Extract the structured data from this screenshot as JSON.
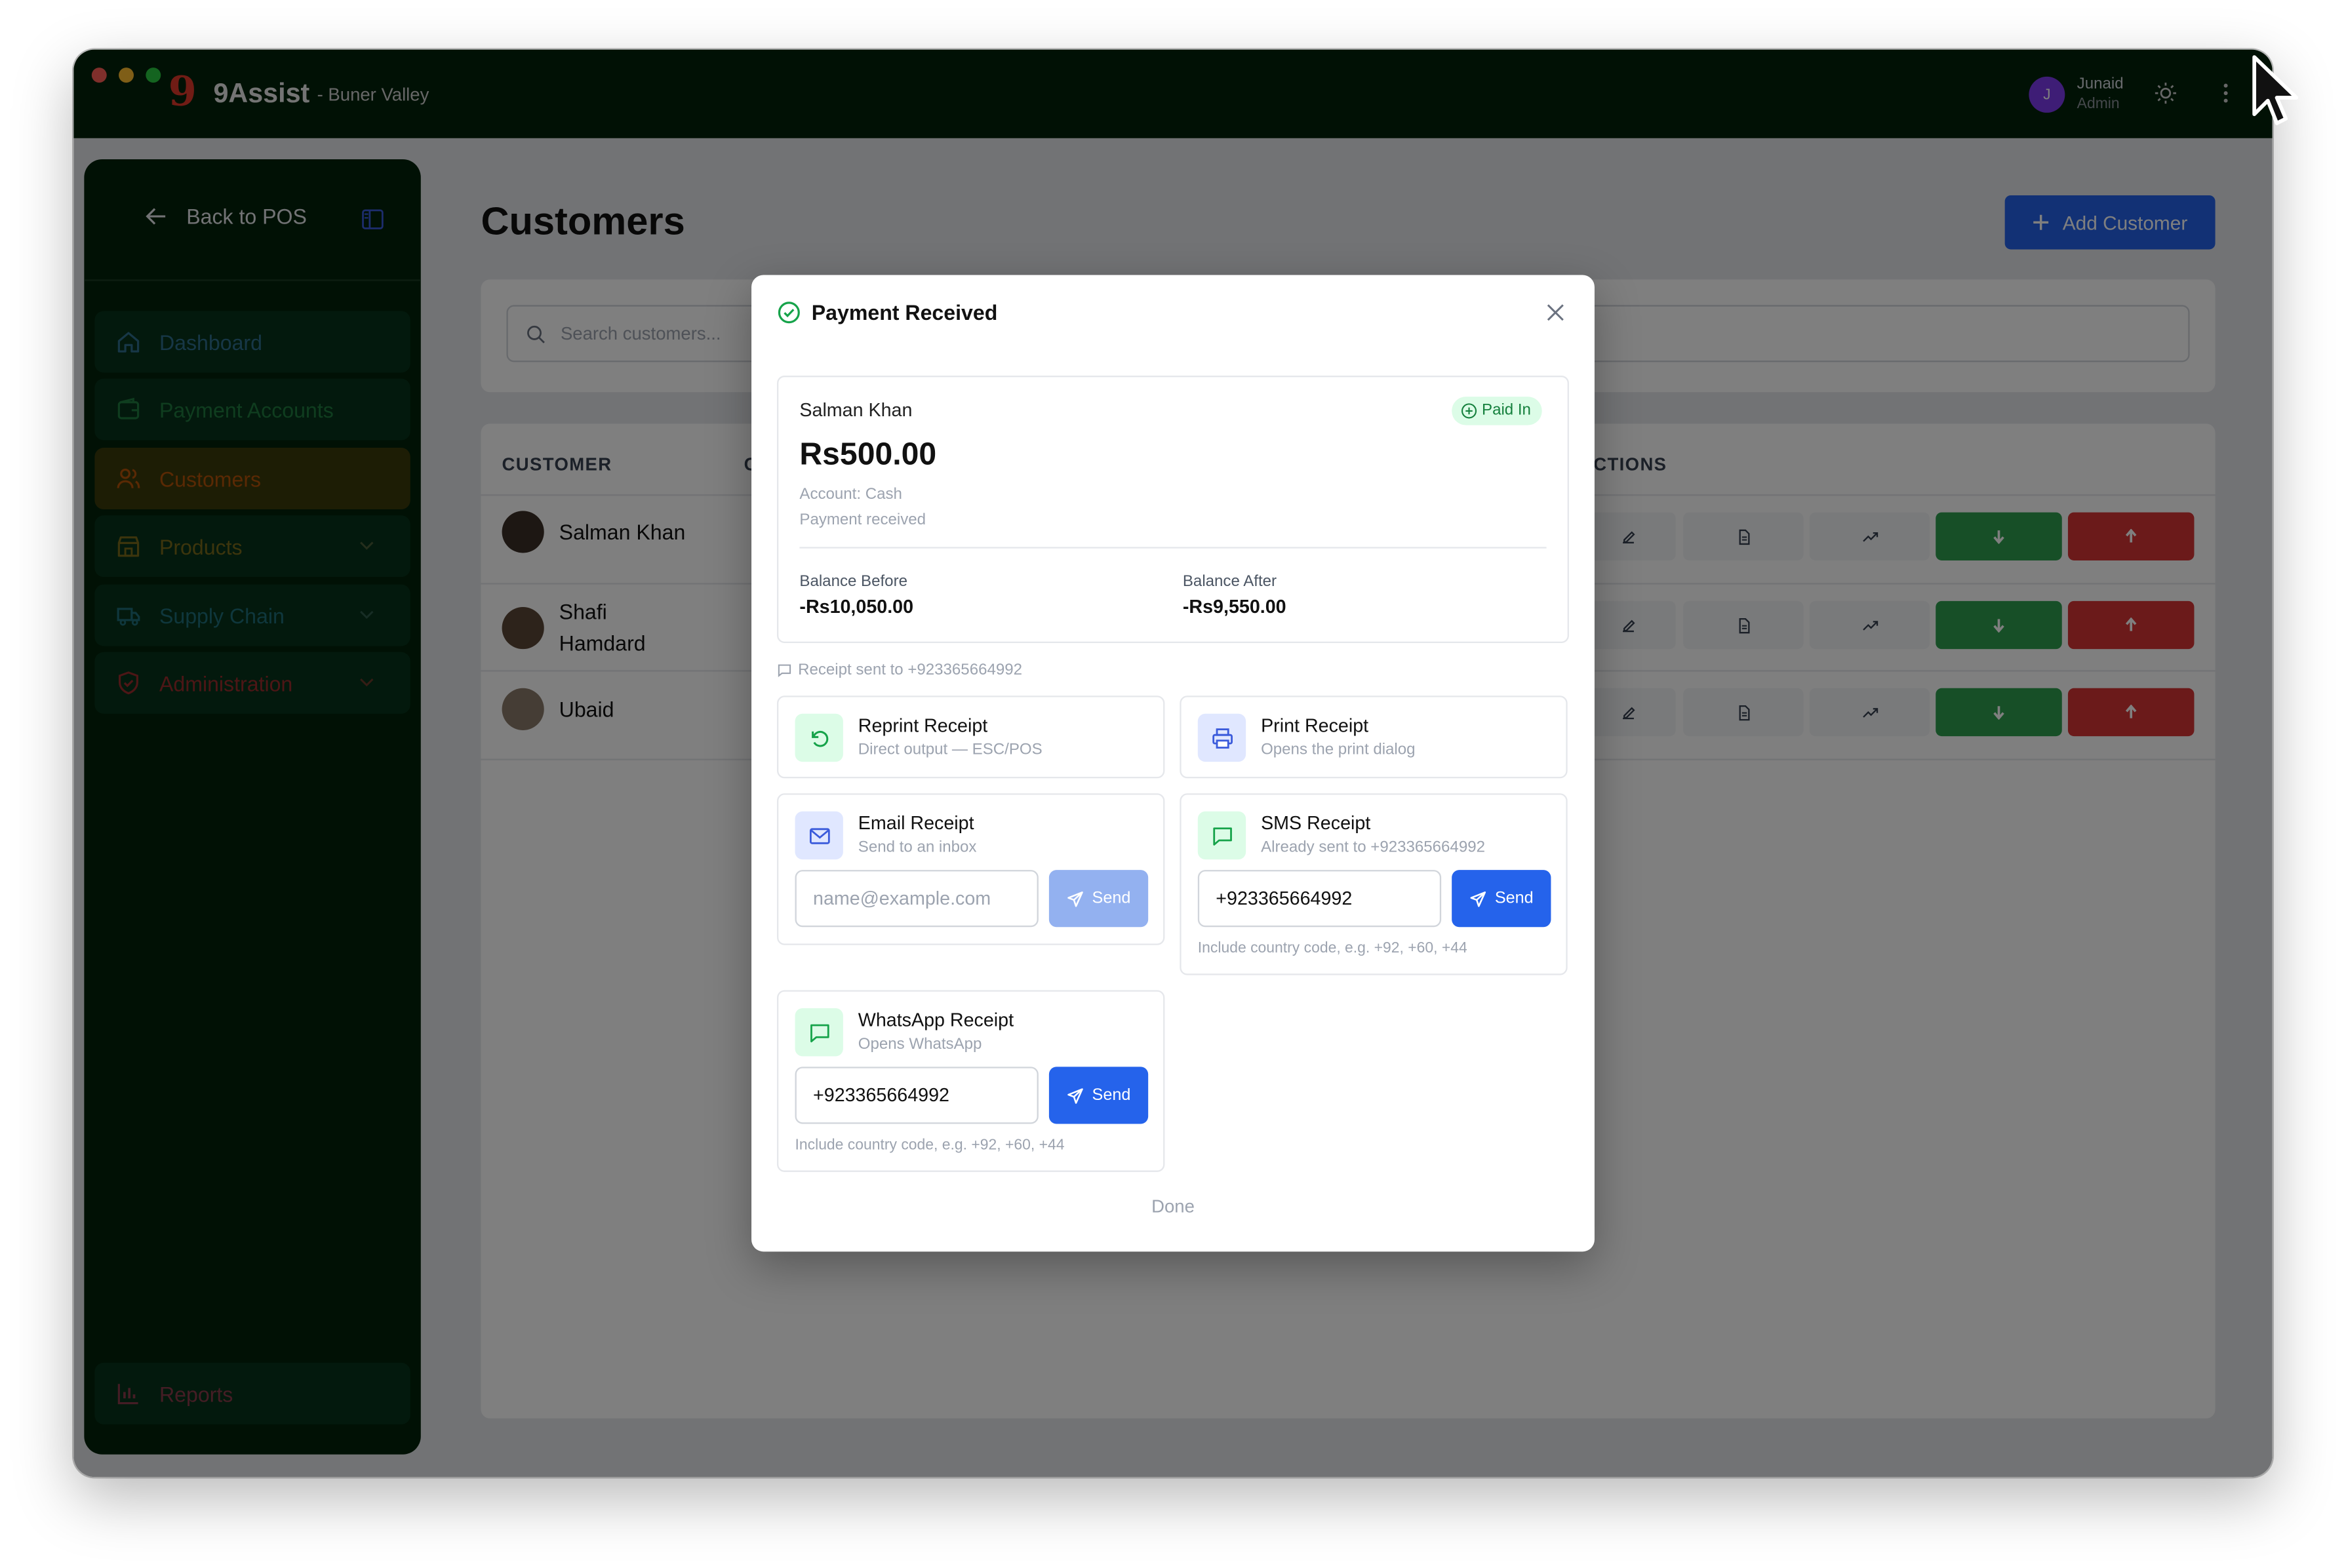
{
  "titlebar": {
    "logo": "9",
    "app_name": "9Assist",
    "location": "- Buner Valley",
    "user_initial": "J",
    "user_name": "Junaid",
    "user_role": "Admin"
  },
  "sidebar": {
    "back_label": "Back to POS",
    "items": [
      {
        "label": "Dashboard",
        "icon": "home-icon",
        "color": "#2f6f8f"
      },
      {
        "label": "Payment Accounts",
        "icon": "wallet-icon",
        "color": "#1f7a3f"
      },
      {
        "label": "Customers",
        "icon": "users-icon",
        "color": "#b45309",
        "active": true
      },
      {
        "label": "Products",
        "icon": "store-icon",
        "color": "#7a6a1a"
      },
      {
        "label": "Supply Chain",
        "icon": "truck-icon",
        "color": "#1f6f7a"
      },
      {
        "label": "Administration",
        "icon": "shield-icon",
        "color": "#9b2c2c"
      }
    ],
    "reports_label": "Reports"
  },
  "main": {
    "title": "Customers",
    "add_label": "Add Customer",
    "search_placeholder": "Search customers...",
    "columns": [
      "CUSTOMER",
      "C",
      "ACTIONS"
    ],
    "rows": [
      {
        "name": "Salman Khan"
      },
      {
        "name": "Shafi Hamdard"
      },
      {
        "name": "Ubaid"
      }
    ]
  },
  "modal": {
    "title": "Payment Received",
    "customer": "Salman Khan",
    "status": "Paid In",
    "amount": "Rs500.00",
    "account": "Account: Cash",
    "note": "Payment received",
    "balance_before_label": "Balance Before",
    "balance_before": "-Rs10,050.00",
    "balance_after_label": "Balance After",
    "balance_after": "-Rs9,550.00",
    "receipt_sent": "Receipt sent to +923365664992",
    "reprint": {
      "title": "Reprint Receipt",
      "desc": "Direct output — ESC/POS"
    },
    "print": {
      "title": "Print Receipt",
      "desc": "Opens the print dialog"
    },
    "email": {
      "title": "Email Receipt",
      "desc": "Send to an inbox",
      "placeholder": "name@example.com",
      "send": "Send"
    },
    "sms": {
      "title": "SMS Receipt",
      "desc": "Already sent to +923365664992",
      "value": "+923365664992",
      "send": "Send",
      "hint": "Include country code, e.g. +92, +60, +44"
    },
    "whatsapp": {
      "title": "WhatsApp Receipt",
      "desc": "Opens WhatsApp",
      "value": "+923365664992",
      "send": "Send",
      "hint": "Include country code, e.g. +92, +60, +44"
    },
    "done": "Done"
  }
}
